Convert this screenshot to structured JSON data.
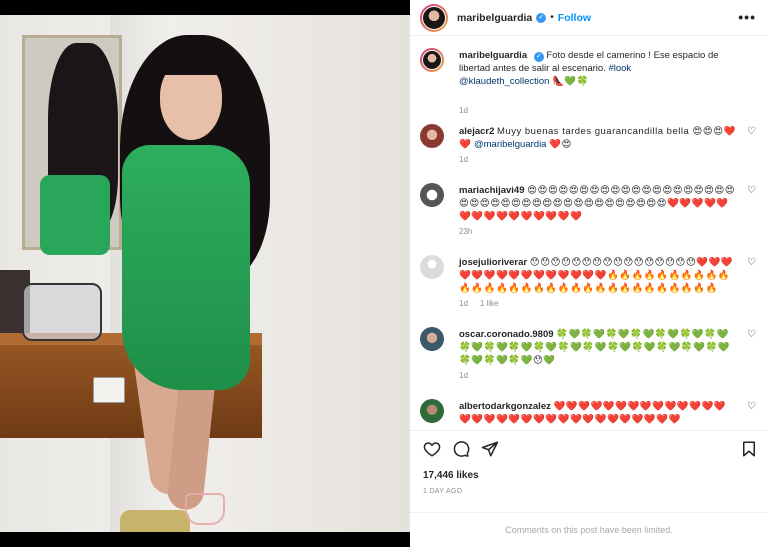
{
  "post": {
    "author": "maribelguardia",
    "follow_label": "Follow",
    "separator": "•",
    "more_label": "•••",
    "caption_text": "Foto desde el camerino ! Ese espacio de libertad antes de salir al escenario.",
    "caption_tag": "#look",
    "caption_mention": "@klaudeth_collection",
    "caption_emoji": "👠💚🍀",
    "caption_time": "1d"
  },
  "comments": [
    {
      "user": "alejacr2",
      "text": "Muyy buenas tardes guarancandilla bella 😍😍😍❤️❤️",
      "mention": "@maribelguardia",
      "tail": "❤️😍",
      "time": "1d",
      "likes": ""
    },
    {
      "user": "mariachijavi49",
      "text": "😍😍😍😍😍😍😍😍😍😍😍😍😍😍😍😍😍😍😍😍😍😍😍😍😍😍😍😍😍😍😍😍😍😍😍😍😍😍😍😍❤️❤️❤️❤️❤️❤️❤️❤️❤️❤️❤️❤️❤️❤️❤️",
      "time": "23h",
      "likes": ""
    },
    {
      "user": "josejulioriverar",
      "text": "😯😯😯😯😯😯😯😯😯😯😯😯😯😯😯😯❤️❤️❤️❤️❤️❤️❤️❤️❤️❤️❤️❤️❤️❤️❤️🔥🔥🔥🔥🔥🔥🔥🔥🔥🔥🔥🔥🔥🔥🔥🔥🔥🔥🔥🔥🔥🔥🔥🔥🔥🔥🔥🔥🔥🔥🔥",
      "time": "1d",
      "likes": "1 like"
    },
    {
      "user": "oscar.coronado.9809",
      "text": "🍀💚🍀💚🍀💚🍀💚🍀💚🍀💚🍀💚🍀💚🍀💚🍀💚🍀💚🍀💚🍀💚🍀💚🍀💚🍀💚🍀💚🍀💚🍀💚🍀💚🍀💚😯💚",
      "time": "1d",
      "likes": ""
    },
    {
      "user": "albertodarkgonzalez",
      "text": "❤️❤️❤️❤️❤️❤️❤️❤️❤️❤️❤️❤️❤️❤️❤️❤️❤️❤️❤️❤️❤️❤️❤️❤️❤️❤️❤️❤️❤️❤️❤️❤️",
      "time": "",
      "likes": ""
    }
  ],
  "footer": {
    "likes": "17,446 likes",
    "ago": "1 DAY AGO",
    "limited_notice": "Comments on this post have been limited."
  },
  "icons": {
    "like": "heart-icon",
    "comment": "comment-icon",
    "share": "send-icon",
    "save": "bookmark-icon",
    "comment_like": "heart-outline-icon"
  },
  "colors": {
    "follow": "#0095f6",
    "link": "#00376b",
    "verified": "#3897f0"
  }
}
